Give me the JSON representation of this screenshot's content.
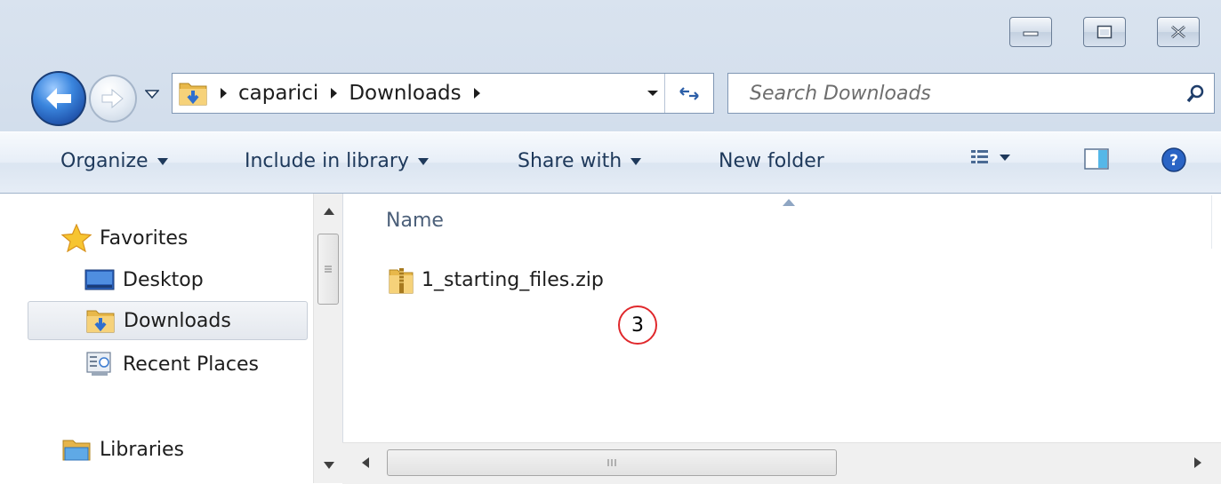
{
  "window": {
    "caption_buttons": [
      "minimize",
      "maximize",
      "close"
    ]
  },
  "address_bar": {
    "crumbs": [
      "caparici",
      "Downloads"
    ],
    "icon": "downloads-folder-icon"
  },
  "search": {
    "placeholder": "Search Downloads"
  },
  "command_bar": {
    "organize": "Organize",
    "include_in_library": "Include in library",
    "share_with": "Share with",
    "new_folder": "New folder",
    "icons": [
      "views-icon",
      "preview-pane-icon",
      "help-icon"
    ]
  },
  "nav_pane": {
    "favorites": "Favorites",
    "items": [
      {
        "label": "Desktop",
        "icon": "desktop-icon"
      },
      {
        "label": "Downloads",
        "icon": "downloads-folder-icon",
        "selected": true
      },
      {
        "label": "Recent Places",
        "icon": "recent-places-icon"
      }
    ],
    "libraries": "Libraries"
  },
  "content": {
    "column_header": "Name",
    "files": [
      {
        "name": "1_starting_files.zip",
        "icon": "zip-folder-icon"
      }
    ],
    "annotation": "3"
  },
  "colors": {
    "accent": "#1e395b",
    "annotation_ring": "#e0282c"
  }
}
